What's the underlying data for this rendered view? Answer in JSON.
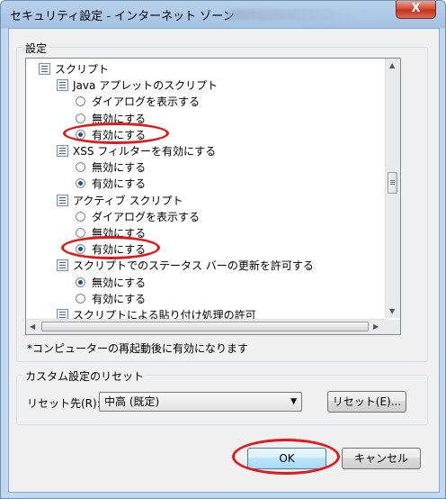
{
  "window": {
    "title": "セキュリティ設定 - インターネット ゾーン",
    "close_label": "X"
  },
  "settings": {
    "legend": "設定",
    "items": [
      {
        "type": "node",
        "label": "スクリプト",
        "indent": 0
      },
      {
        "type": "node",
        "label": "Java アプレットのスクリプト",
        "indent": 1
      },
      {
        "type": "radio",
        "label": "ダイアログを表示する",
        "checked": false
      },
      {
        "type": "radio",
        "label": "無効にする",
        "checked": false
      },
      {
        "type": "radio",
        "label": "有効にする",
        "checked": true
      },
      {
        "type": "node",
        "label": "XSS フィルターを有効にする",
        "indent": 1
      },
      {
        "type": "radio",
        "label": "無効にする",
        "checked": false
      },
      {
        "type": "radio",
        "label": "有効にする",
        "checked": true
      },
      {
        "type": "node",
        "label": "アクティブ スクリプト",
        "indent": 1
      },
      {
        "type": "radio",
        "label": "ダイアログを表示する",
        "checked": false
      },
      {
        "type": "radio",
        "label": "無効にする",
        "checked": false
      },
      {
        "type": "radio",
        "label": "有効にする",
        "checked": true
      },
      {
        "type": "node",
        "label": "スクリプトでのステータス バーの更新を許可する",
        "indent": 1
      },
      {
        "type": "radio",
        "label": "無効にする",
        "checked": true
      },
      {
        "type": "radio",
        "label": "有効にする",
        "checked": false
      },
      {
        "type": "node",
        "label": "スクリプトによる貼り付け処理の許可",
        "indent": 1
      }
    ],
    "note": "*コンピューターの再起動後に有効になります"
  },
  "reset": {
    "legend": "カスタム設定のリセット",
    "label": "リセット先(R):",
    "selected": "中高 (既定)",
    "button": "リセット(E)..."
  },
  "buttons": {
    "ok": "OK",
    "cancel": "キャンセル"
  },
  "colors": {
    "highlight_ellipse": "#e0191a",
    "radio_checked": "#1f4f8f"
  }
}
